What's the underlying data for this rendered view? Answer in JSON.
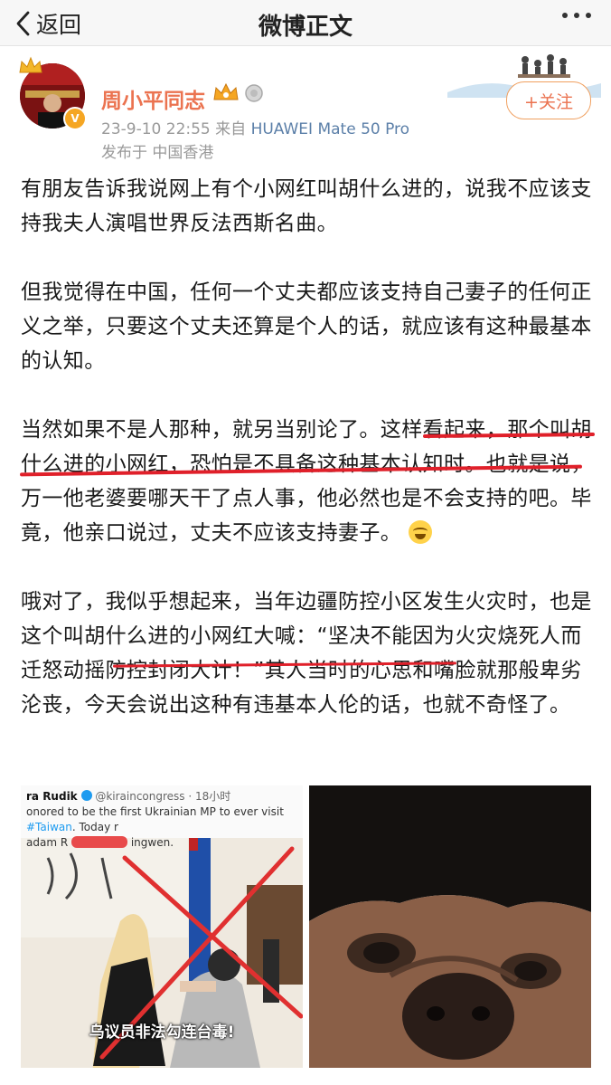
{
  "nav": {
    "back_label": "返回",
    "title": "微博正文"
  },
  "author": {
    "name": "周小平同志",
    "date": "23-9-10 22:55",
    "source_prefix": "来自",
    "device": "HUAWEI Mate 50 Pro",
    "location": "发布于 中国香港",
    "follow_label": "+关注"
  },
  "post": {
    "paragraphs": [
      "有朋友告诉我说网上有个小网红叫胡什么进的，说我不应该支持我夫人演唱世界反法西斯名曲。",
      "但我觉得在中国，任何一个丈夫都应该支持自己妻子的任何正义之举，只要这个丈夫还算是个人的话，就应该有这种最基本的认知。",
      " 当然如果不是人那种，就另当别论了。这样看起来，那个叫胡什么进的小网红，恐怕是不具备这种基本认知时。也就是说，万一他老婆要哪天干了点人事，他必然也是不会支持的吧。毕竟，他亲口说过，丈夫不应该支持妻子。",
      " 哦对了，我似乎想起来，当年边疆防控小区发生火灾时，也是这个叫胡什么进的小网红大喊：“坚决不能因为火灾烧死人而迁怒动摇防控封闭大计！”其人当时的心思和嘴脸就那般卑劣沦丧，今天会说出这种有违基本人伦的话，也就不奇怪了。"
    ],
    "emoji": "laugh-cry-icon"
  },
  "images": {
    "left": {
      "tweet_name": "ra Rudik",
      "tweet_handle": "@kiraincongress · 18小时",
      "tweet_line1": "onored to be the first Ukrainian MP to ever visit",
      "tweet_hashtag": "#Taiwan",
      "tweet_line1_end": ". Today r",
      "tweet_line2": "adam R",
      "tweet_line2_end": "ingwen.",
      "caption": "乌议员非法勾连台毒!"
    },
    "right": {
      "subject": "pug-face-photo"
    }
  },
  "colors": {
    "accent": "#eb7350",
    "link": "#5b7fa8",
    "annotation_red": "#e0202a"
  }
}
